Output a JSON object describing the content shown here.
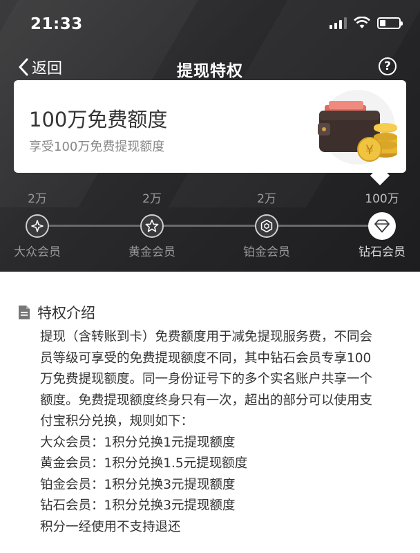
{
  "status": {
    "time": "21:33"
  },
  "nav": {
    "back_label": "返回",
    "title": "提现特权",
    "help_label": "?"
  },
  "card": {
    "title": "100万免费额度",
    "subtitle": "享受100万免费提现额度",
    "coin_glyph": "¥"
  },
  "levels": [
    {
      "amount": "2万",
      "name": "大众会员",
      "icon": "star-4-icon"
    },
    {
      "amount": "2万",
      "name": "黄金会员",
      "icon": "star-5-icon"
    },
    {
      "amount": "2万",
      "name": "铂金会员",
      "icon": "hexagon-icon"
    },
    {
      "amount": "100万",
      "name": "钻石会员",
      "icon": "diamond-icon",
      "active": true
    }
  ],
  "section": {
    "title": "特权介绍",
    "lines": [
      "提现（含转账到卡）免费额度用于减免提现服务费，不同会",
      "员等级可享受的免费提现额度不同，其中钻石会员专享100",
      "万免费提现额度。同一身份证号下的多个实名账户共享一个",
      "额度。免费提现额度终身只有一次，超出的部分可以使用支",
      "付宝积分兑换，规则如下：",
      "大众会员：1积分兑换1元提现额度",
      "黄金会员：1积分兑换1.5元提现额度",
      "铂金会员：1积分兑换3元提现额度",
      "钻石会员：1积分兑换3元提现额度",
      "积分一经使用不支持退还"
    ]
  },
  "colors": {
    "header_bg": "#2a2a2c",
    "wallet_red": "#e46a5e",
    "coin_gold": "#e8b630"
  }
}
